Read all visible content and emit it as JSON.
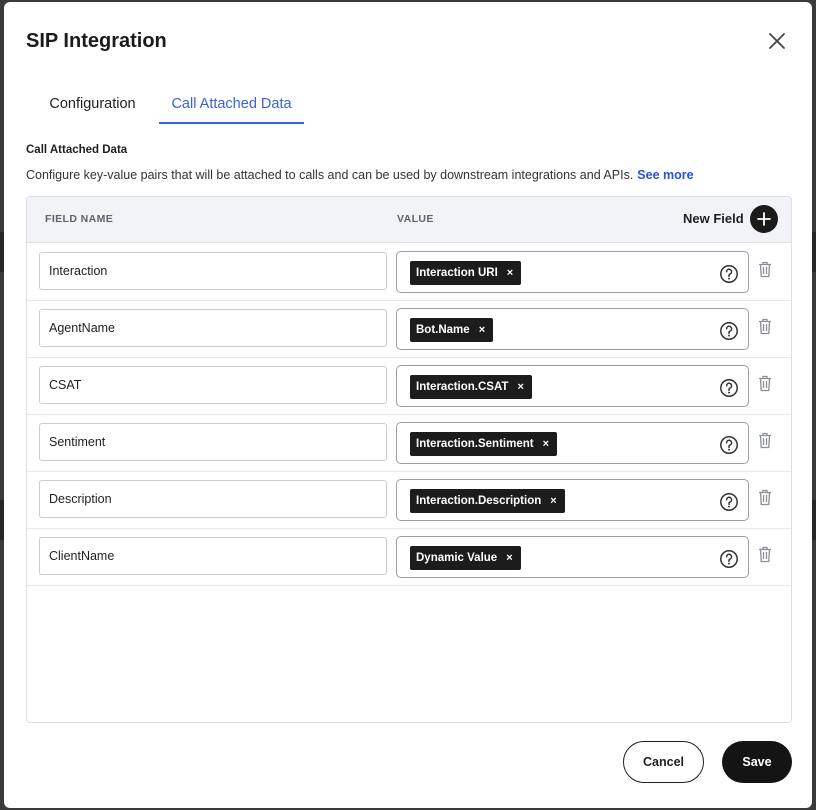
{
  "dialog": {
    "title": "SIP Integration",
    "close_icon": "close-icon"
  },
  "tabs": [
    {
      "label": "Configuration",
      "active": false
    },
    {
      "label": "Call Attached Data",
      "active": true
    }
  ],
  "section": {
    "title": "Call Attached Data",
    "description": "Configure key-value pairs that will be attached to calls and can be used by downstream integrations and APIs.",
    "link": "See more"
  },
  "table": {
    "headers": {
      "field_name": "FIELD NAME",
      "value": "VALUE"
    },
    "new_field_label": "New Field",
    "rows": [
      {
        "field": "Interaction",
        "value": "Interaction URI"
      },
      {
        "field": "AgentName",
        "value": "Bot.Name"
      },
      {
        "field": "CSAT",
        "value": "Interaction.CSAT"
      },
      {
        "field": "Sentiment",
        "value": "Interaction.Sentiment"
      },
      {
        "field": "Description",
        "value": "Interaction.Description"
      },
      {
        "field": "ClientName",
        "value": "Dynamic Value"
      }
    ],
    "chip_remove_glyph": "×"
  },
  "footer": {
    "cancel_label": "Cancel",
    "save_label": "Save"
  },
  "colors": {
    "accent": "#3a63d8",
    "link": "#2752d6",
    "primary_button": "#141414"
  }
}
